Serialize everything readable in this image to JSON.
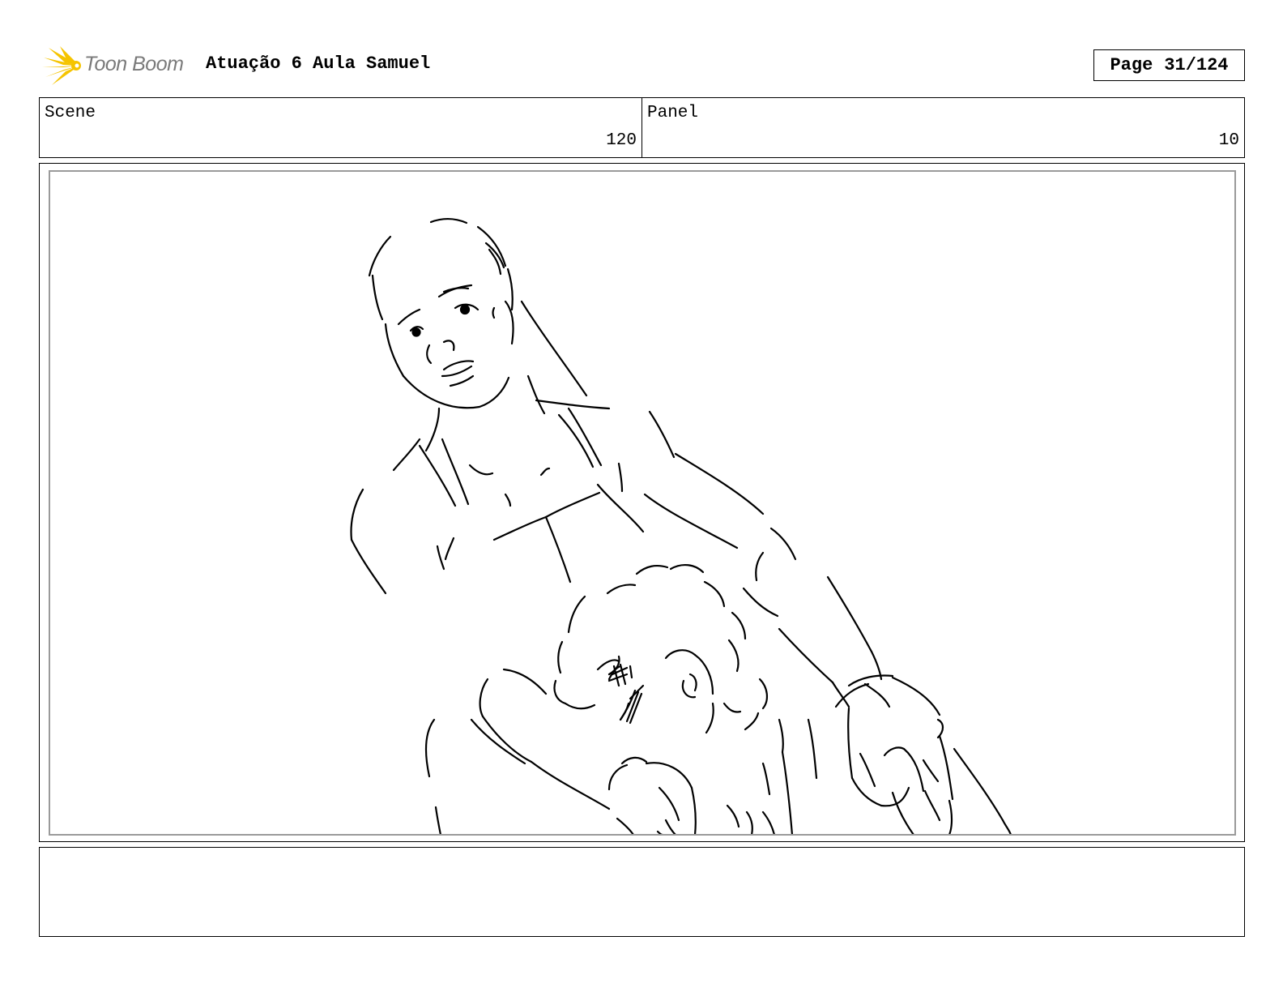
{
  "header": {
    "logo_text": "Toon Boom",
    "logo_icon": "toon-boom-starburst-icon",
    "title": "Atuação 6 Aula Samuel",
    "page_label": "Page",
    "page_number": "31/124"
  },
  "info": {
    "scene_label": "Scene",
    "scene_value": "120",
    "panel_label": "Panel",
    "panel_value": "10"
  },
  "drawing": {
    "description_icon": "storyboard-sketch"
  },
  "notes": {
    "text": ""
  },
  "colors": {
    "logo_yellow": "#f5c400",
    "logo_text_gray": "#7a7a7a",
    "panel_border_gray": "#9a9a9a"
  }
}
